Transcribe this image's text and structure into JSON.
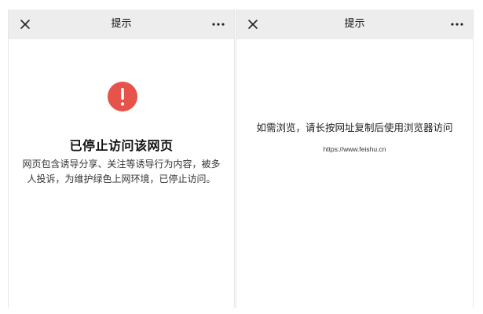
{
  "left_panel": {
    "nav": {
      "title": "提示",
      "close_icon": "close-icon",
      "more_icon": "more-icon"
    },
    "warning": {
      "icon": "exclamation-icon",
      "icon_color": "#e5534b",
      "title": "已停止访问该网页",
      "description": "网页包含诱导分享、关注等诱导行为内容，被多人投诉，为维护绿色上网环境，已停止访问。"
    }
  },
  "right_panel": {
    "nav": {
      "title": "提示",
      "close_icon": "close-icon",
      "more_icon": "more-icon"
    },
    "hint": "如需浏览，请长按网址复制后使用浏览器访问",
    "url": "https://www.feishu.cn"
  },
  "colors": {
    "navbar_bg": "#ededed",
    "accent_red": "#e5534b"
  }
}
